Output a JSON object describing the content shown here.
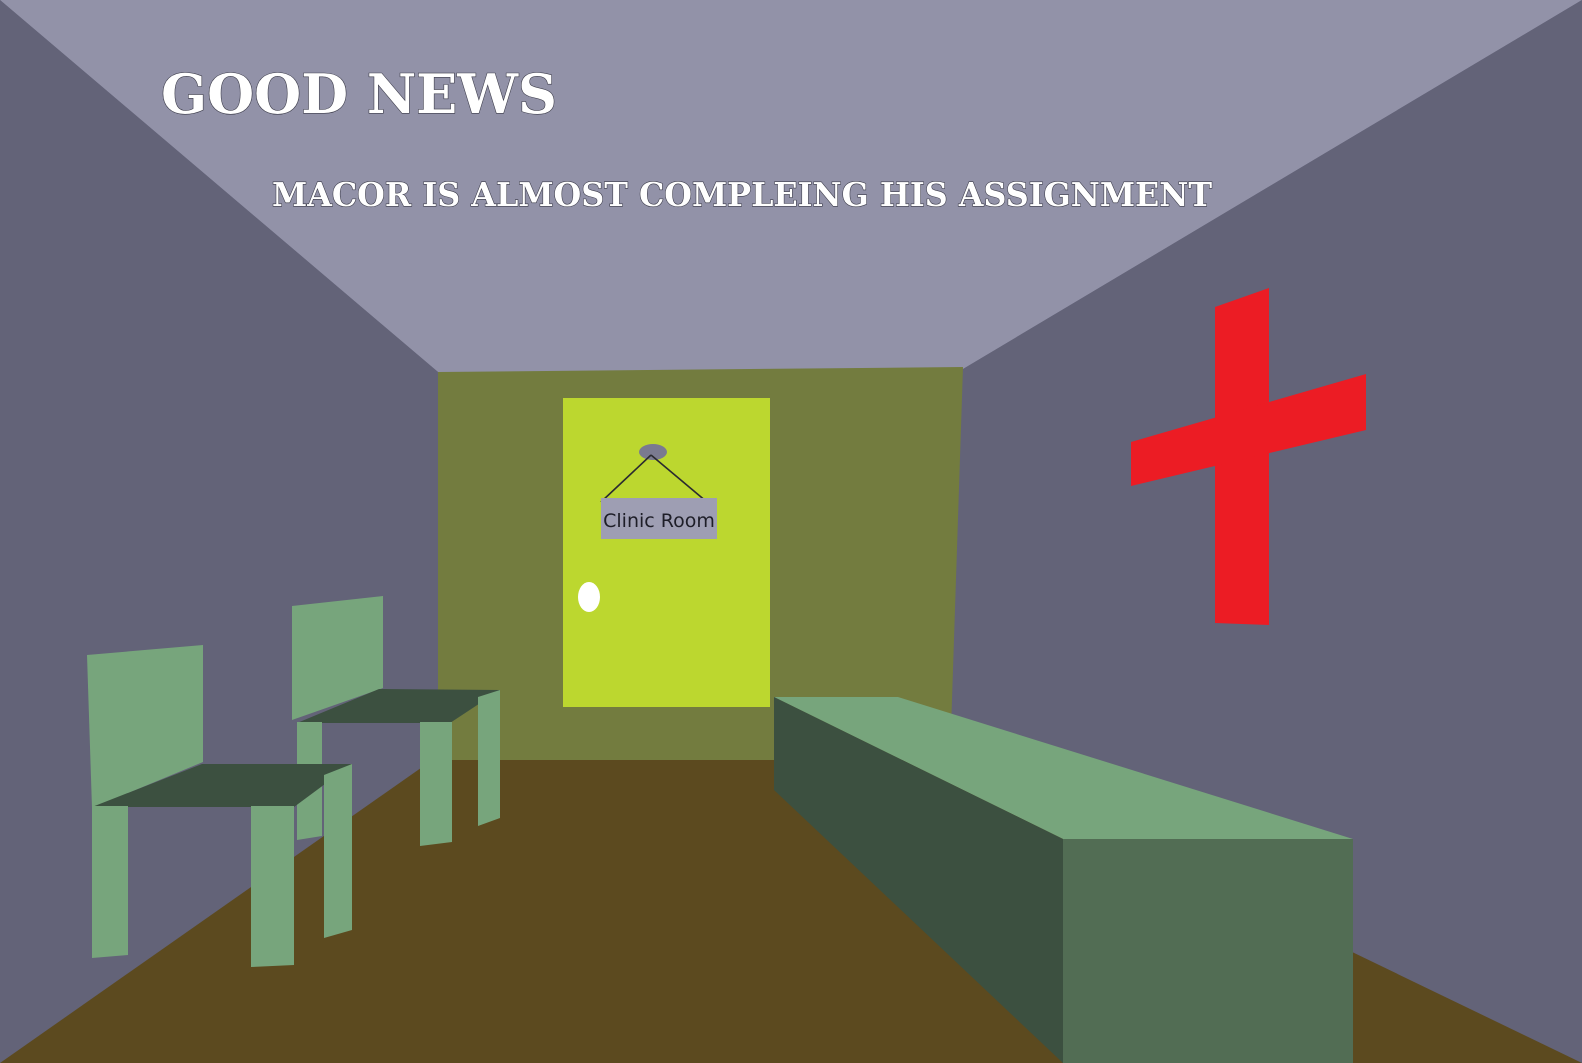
{
  "headline": "GOOD NEWS",
  "subheadline": "MACOR IS ALMOST COMPLEING HIS ASSIGNMENT",
  "door_sign": "Clinic Room",
  "colors": {
    "ceiling": "#9292a8",
    "side_walls": "#636378",
    "back_wall": "#737c3f",
    "floor": "#5c4a1f",
    "door": "#bcd72f",
    "door_knob": "#ffffff",
    "sign": "#9e9eb3",
    "cross": "#ec1c24",
    "furniture_light": "#77a57c",
    "furniture_dark": "#3c5040",
    "furniture_mid": "#526d54"
  },
  "icons": [
    "red-cross-icon",
    "chair-icon",
    "door-icon"
  ]
}
